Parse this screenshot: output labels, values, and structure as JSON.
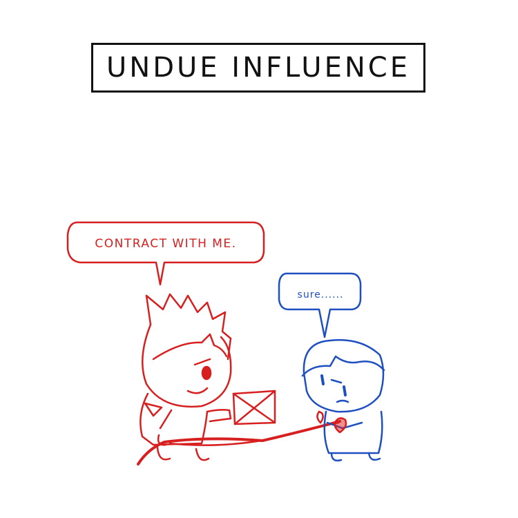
{
  "title": "UNDUE INFLUENCE",
  "red_character": {
    "speech": "CONTRACT WITH ME.",
    "color": "#d81f1f"
  },
  "blue_character": {
    "speech": "sure......",
    "color": "#1e4fc2"
  },
  "title_color": "#111111",
  "icons": [
    "envelope-icon",
    "heart-icon"
  ]
}
